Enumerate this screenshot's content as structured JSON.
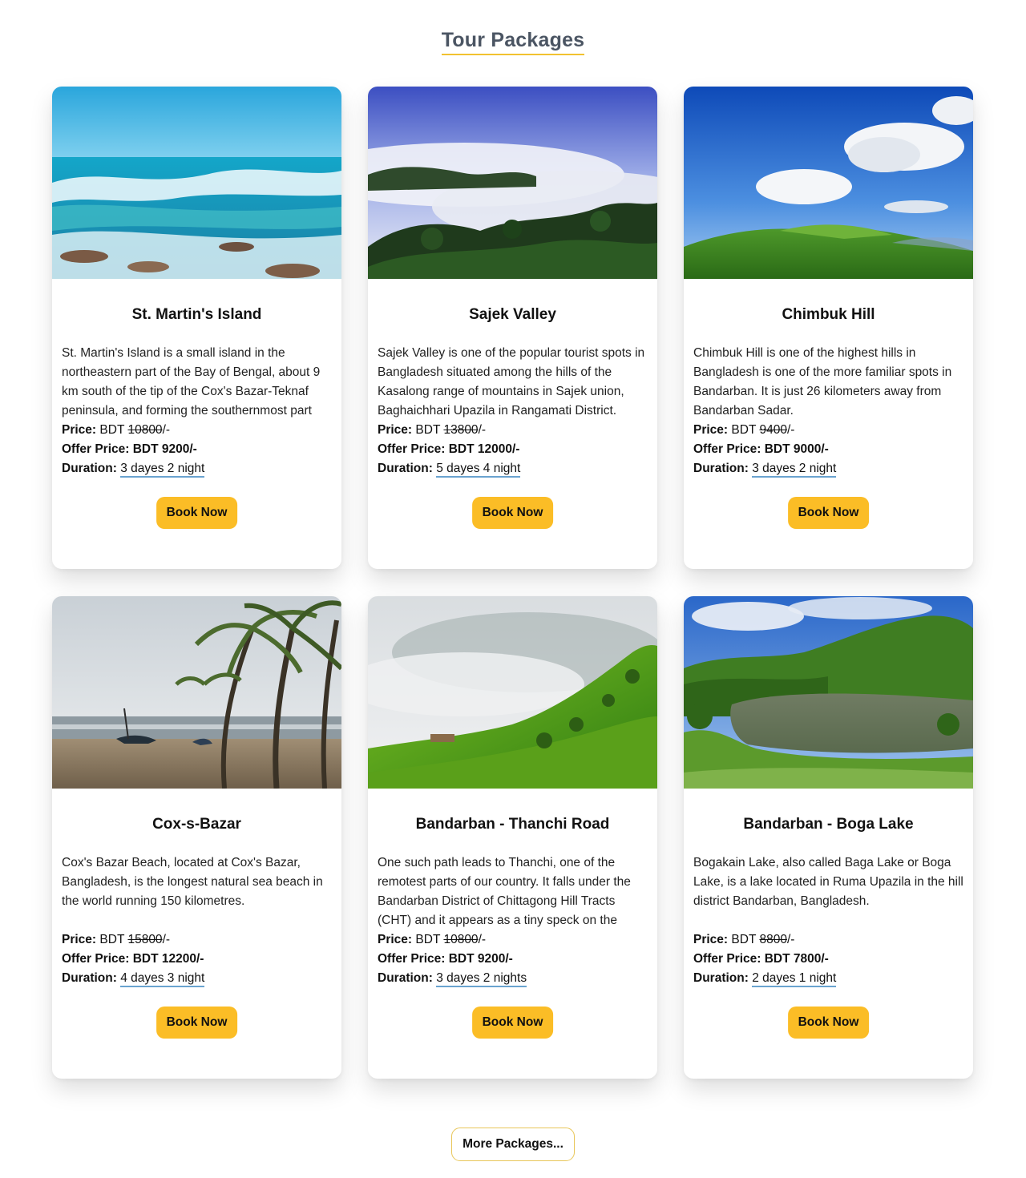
{
  "section": {
    "title": "Tour Packages"
  },
  "labels": {
    "price": "Price:",
    "currency": "BDT",
    "suffix": "/-",
    "offer_price": "Offer Price:",
    "duration": "Duration:",
    "book_now": "Book Now"
  },
  "packages": [
    {
      "title": "St. Martin's Island",
      "description": "St. Martin's Island is a small island in the northeastern part of the Bay of Bengal, about 9 km south of the tip of the Cox's Bazar-Teknaf peninsula, and forming the southernmost part",
      "price": "10800",
      "offer_price": "BDT 9200/-",
      "duration": "3 dayes 2 night",
      "image": "sea-waves-photo"
    },
    {
      "title": "Sajek Valley",
      "description": "Sajek Valley is one of the popular tourist spots in Bangladesh situated among the hills of the Kasalong range of mountains in Sajek union, Baghaichhari Upazila in Rangamati District.",
      "price": "13800",
      "offer_price": "BDT 12000/-",
      "duration": "5 dayes 4 night",
      "image": "misty-valley-photo"
    },
    {
      "title": "Chimbuk Hill",
      "description": "Chimbuk Hill is one of the highest hills in Bangladesh is one of the more familiar spots in Bandarban. It is just 26 kilometers away from Bandarban Sadar.",
      "price": "9400",
      "offer_price": "BDT 9000/-",
      "duration": "3 dayes 2 night",
      "image": "green-hill-photo"
    },
    {
      "title": "Cox-s-Bazar",
      "description": "Cox's Bazar Beach, located at Cox's Bazar, Bangladesh, is the longest natural sea beach in the world running 150 kilometres.",
      "price": "15800",
      "offer_price": "BDT 12200/-",
      "duration": "4 dayes 3 night",
      "image": "palm-beach-photo"
    },
    {
      "title": "Bandarban - Thanchi Road",
      "description": "One such path leads to Thanchi, one of the remotest parts of our country. It falls under the Bandarban District of Chittagong Hill Tracts (CHT) and it appears as a tiny speck on the",
      "price": "10800",
      "offer_price": "BDT 9200/-",
      "duration": "3 dayes 2 nights",
      "image": "foggy-hillside-photo"
    },
    {
      "title": "Bandarban - Boga Lake",
      "description": "Bogakain Lake, also called Baga Lake or Boga Lake, is a lake located in Ruma Upazila in the hill district Bandarban, Bangladesh.",
      "price": "8800",
      "offer_price": "BDT 7800/-",
      "duration": "2 dayes 1 night",
      "image": "hill-lake-photo"
    }
  ],
  "more_button": "More Packages..."
}
